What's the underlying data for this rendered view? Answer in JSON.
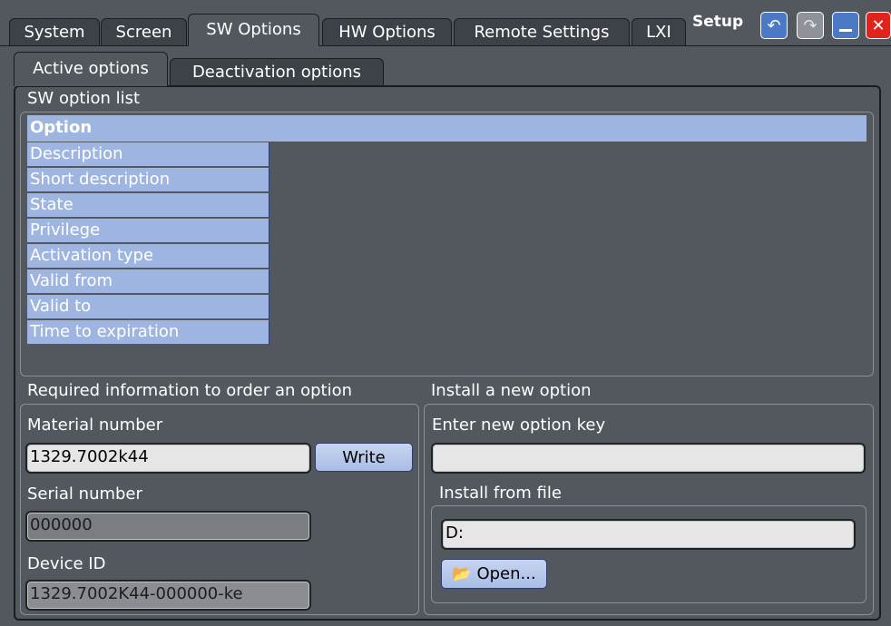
{
  "top_tabs": [
    "System",
    "Screen",
    "SW Options",
    "HW Options",
    "Remote Settings",
    "LXI"
  ],
  "active_top_tab": "SW Options",
  "window_title": "Setup",
  "window_buttons": {
    "undo": "undo-icon",
    "redo": "redo-icon",
    "minimize": "minimize-icon",
    "close": "close-icon"
  },
  "sub_tabs": [
    "Active options",
    "Deactivation options"
  ],
  "option_list": {
    "title": "SW option list",
    "header": "Option",
    "rows": [
      "Description",
      "Short description",
      "State",
      "Privilege",
      "Activation type",
      "Valid from",
      "Valid to",
      "Time to expiration"
    ]
  },
  "order_info": {
    "title": "Required information to order an option",
    "material_label": "Material number",
    "material_value": "1329.7002k44",
    "write_button": "Write",
    "serial_label": "Serial number",
    "serial_value": "000000",
    "device_label": "Device ID",
    "device_value": "1329.7002K44-000000-ke"
  },
  "install": {
    "title": "Install a new option",
    "key_label": "Enter new option key",
    "key_value": "",
    "file_title": "Install from file",
    "file_value": "D:",
    "open_button": "Open..."
  },
  "colors": {
    "background": "#53585f",
    "header_blue": "#9fb5e1",
    "button_blue": "#4c79c6",
    "close_red": "#e0241b"
  }
}
